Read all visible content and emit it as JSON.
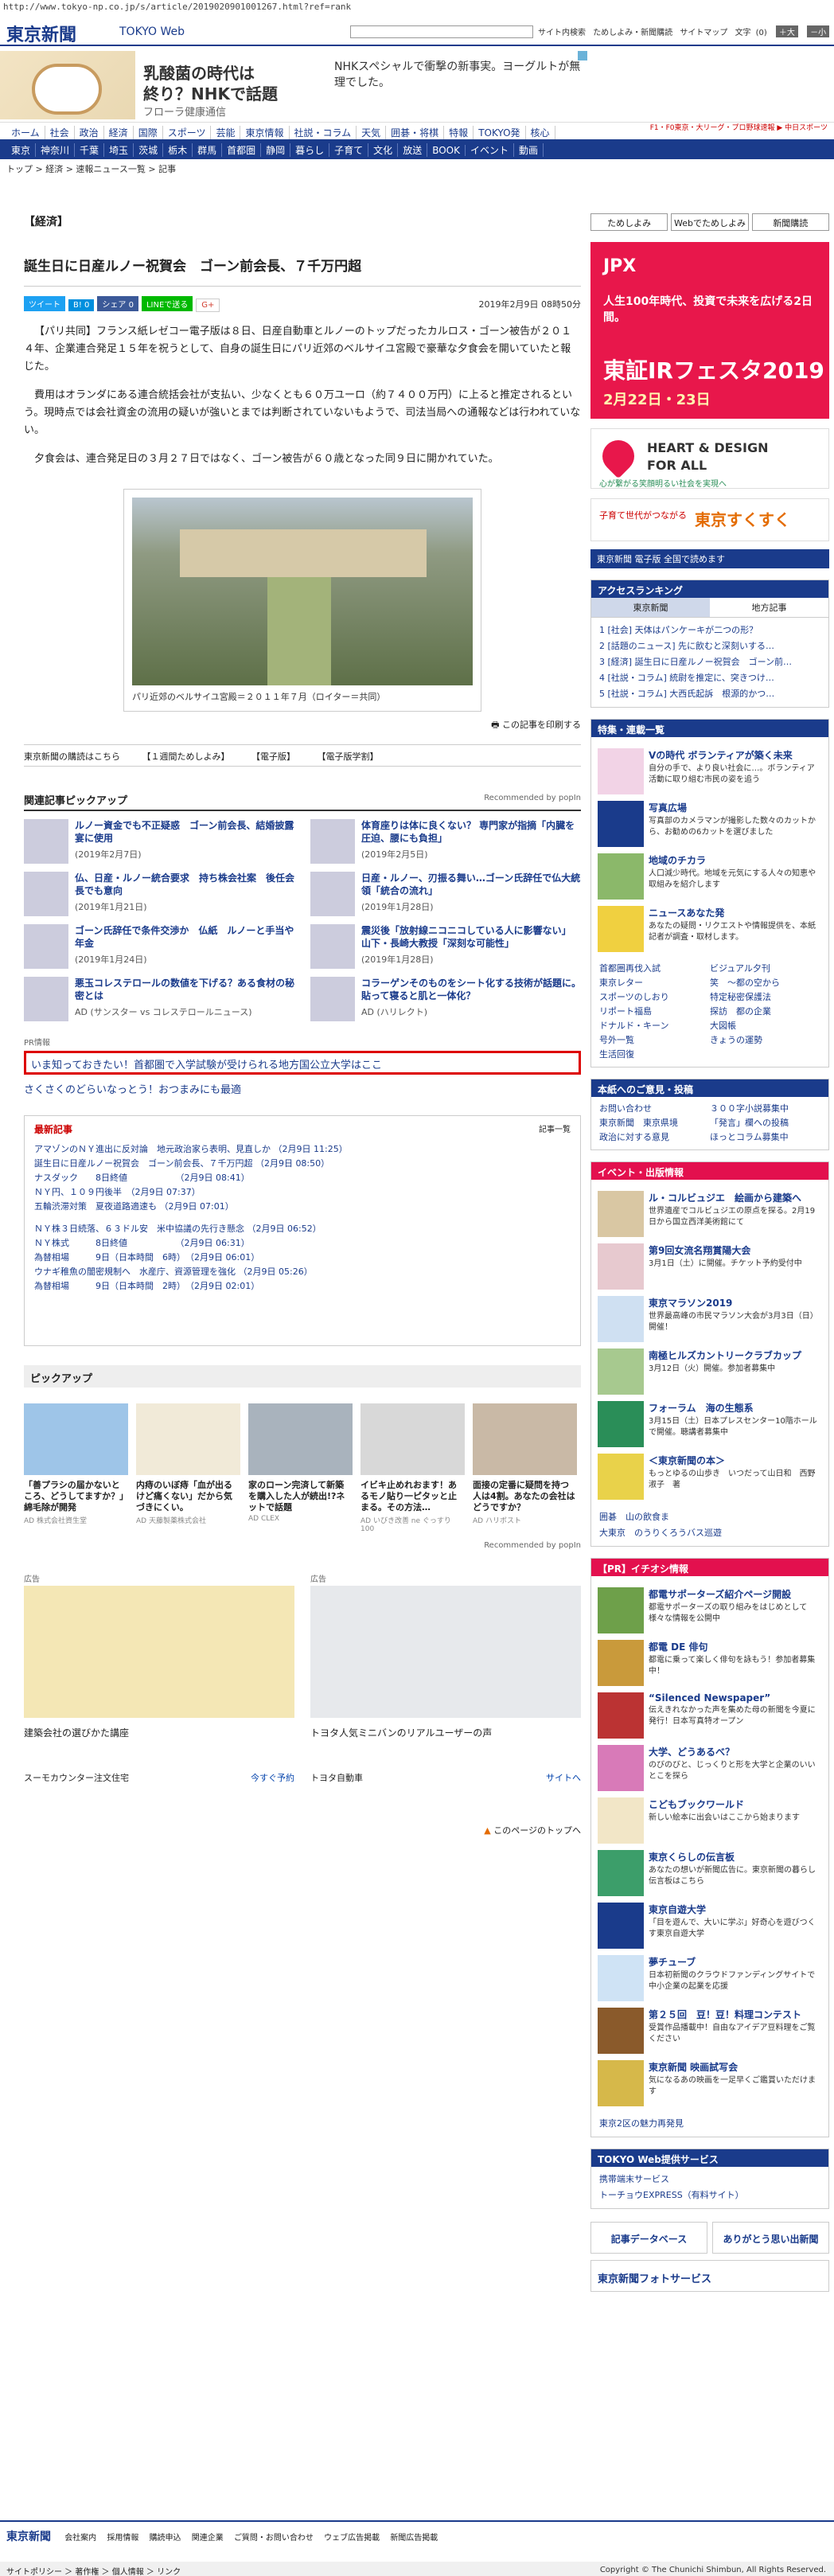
{
  "url": "http://www.tokyo-np.co.jp/s/article/2019020901001267.html?ref=rank",
  "header": {
    "logo": "東京新聞",
    "logo_sub": "TOKYO Web",
    "links": [
      "サイト内検索",
      "ためしよみ・新聞購読",
      "サイトマップ",
      "文字"
    ],
    "text_size": "(0)",
    "text_plus": "＋大",
    "text_minus": "－小"
  },
  "ad_top": {
    "headline1": "乳酸菌の時代は",
    "headline2": "終り？NHKで話題",
    "brand": "フローラ健康通信",
    "right_text": "NHKスペシャルで衝撃の新事実。ヨーグルトが無理でした。"
  },
  "nav1": [
    "ホーム",
    "社会",
    "政治",
    "経済",
    "国際",
    "スポーツ",
    "芸能",
    "東京情報",
    "社説・コラム",
    "天気",
    "囲碁・将棋",
    "特報",
    "TOKYO発",
    "核心"
  ],
  "nav1_right": "F1・F0東京・大リーグ・プロ野球速報 ▶ 中日スポーツ",
  "nav2": [
    "東京",
    "神奈川",
    "千葉",
    "埼玉",
    "茨城",
    "栃木",
    "群馬",
    "首都圏",
    "静岡",
    "暮らし",
    "子育て",
    "文化",
    "放送",
    "BOOK",
    "イベント",
    "動画"
  ],
  "breadcrumb": "トップ > 経済 > 速報ニュース一覧 > 記事",
  "article": {
    "section": "【経済】",
    "title": "誕生日に日産ルノー祝賀会　ゴーン前会長、７千万円超",
    "date": "2019年2月9日 08時50分",
    "share": [
      "ツイート",
      "B! 0",
      "シェア 0",
      "LINEで送る",
      "G+"
    ],
    "paragraphs": [
      "【パリ共同】フランス紙レゼコー電子版は８日、日産自動車とルノーのトップだったカルロス・ゴーン被告が２０１４年、企業連合発足１５年を祝うとして、自身の誕生日にパリ近郊のベルサイユ宮殿で豪華な夕食会を開いていたと報じた。",
      "費用はオランダにある連合統括会社が支払い、少なくとも６０万ユーロ（約７４００万円）に上ると推定されるという。現時点では会社資金の流用の疑いが強いとまでは判断されていないもようで、司法当局への通報などは行われていない。",
      "夕食会は、連合発足日の３月２７日ではなく、ゴーン被告が６０歳となった同９日に開かれていた。"
    ],
    "photo_caption": "パリ近郊のベルサイユ宮殿＝２０１１年７月（ロイター＝共同）",
    "print_label": "この記事を印刷する"
  },
  "linkbar": [
    "東京新聞の購読はこちら",
    "【１週間ためしよみ】",
    "【電子版】",
    "【電子版学割】"
  ],
  "related": {
    "heading": "関連記事ピックアップ",
    "recommend": "Recommended by popIn",
    "items": [
      {
        "title": "ルノー資金でも不正疑惑　ゴーン前会長、結婚披露宴に使用",
        "date": "(2019年2月7日)"
      },
      {
        "title": "体育座りは体に良くない？ 専門家が指摘「内臓を圧迫、腰にも負担」",
        "date": "(2019年2月5日)"
      },
      {
        "title": "仏、日産・ルノー統合要求　持ち株会社案　後任会長でも意向",
        "date": "(2019年1月21日)"
      },
      {
        "title": "日産・ルノー、刃振る舞い…ゴーン氏辞任で仏大統領「統合の流れ」",
        "date": "(2019年1月28日)"
      },
      {
        "title": "ゴーン氏辞任で条件交渉か　仏紙　ルノーと手当や年金",
        "date": "(2019年1月24日)"
      },
      {
        "title": "震災後「放射線ニコニコしている人に影響ない」 山下・長崎大教授「深刻な可能性」",
        "date": "(2019年1月28日)"
      },
      {
        "title": "悪玉コレステロールの数値を下げる？ある食材の秘密とは",
        "date": "AD (サンスター vs コレステロールニュース)"
      },
      {
        "title": "コラーゲンそのものをシート化する技術が話題に。貼って寝ると肌と一体化？",
        "date": "AD (ハリレクト)"
      }
    ]
  },
  "pr": {
    "label": "PR情報",
    "highlight": "いま知っておきたい！首都圏で入学試験が受けられる地方国公立大学はここ",
    "line2": "さくさくのどらいなっとう！おつまみにも最適"
  },
  "latest": {
    "heading": "最新記事",
    "all_link": "記事一覧",
    "items": [
      "アマゾンのＮＹ進出に反対論　地元政治家ら表明、見直しか （2月9日 11:25）",
      "誕生日に日産ルノー祝賀会　ゴーン前会長、７千万円超 （2月9日 08:50）",
      "ナスダック　　8日終値　　　　　　（2月9日 08:41）",
      "ＮＹ円、１０９円後半　（2月9日 07:37）",
      "五輪渋滞対策　夏夜道路適速も （2月9日 07:01）",
      "ＮＹ株３日続落、６３ドル安　米中協議の先行き懸念 （2月9日 06:52）",
      "ＮＹ株式　　　8日終値　　　　　　（2月9日 06:31）",
      "為替相場　　　9日（日本時間　6時）　（2月9日 06:01）",
      "ウナギ稚魚の闇密規制へ　水産庁、資源管理を強化 （2月9日 05:26）",
      "為替相場　　　9日（日本時間　2時）　（2月9日 02:01）"
    ]
  },
  "pickup": {
    "heading": "ピックアップ",
    "items": [
      {
        "title": "「善プラシの届かないところ、どうしてますか？」綿毛除が開発",
        "ad": "AD 株式会社資生堂"
      },
      {
        "title": "内痔のいぼ痔「血が出るけど痛くない」だから気づきにくい。",
        "ad": "AD 天藤製薬株式会社"
      },
      {
        "title": "家のローン完済して新築を購入した人が続出!?ネットで話題",
        "ad": "AD CLEX"
      },
      {
        "title": "イビキ止めれおます！あるモノ貼り一ピタッと止まる。その方法…",
        "ad": "AD いびき改善 ne ぐっすり 100"
      },
      {
        "title": "面接の定番に疑問を持つ人は4割。あなたの会社はどうですか？",
        "ad": "AD ハリボスト"
      }
    ],
    "recommend": "Recommended by popIn"
  },
  "ads_bottom": [
    {
      "label": "広告",
      "title": "建築会社の選びかた講座",
      "brand": "スーモカウンター注文住宅",
      "cta": "今すぐ予約"
    },
    {
      "label": "広告",
      "title": "トヨタ人気ミニバンのリアルユーザーの声",
      "brand": "トヨタ自動車",
      "cta": "サイトへ"
    }
  ],
  "page_top": "このページのトップへ",
  "sidebar": {
    "buttons": [
      "ためしよみ",
      "Webでためしよみ",
      "新聞購読"
    ],
    "banner": {
      "t1": "JPX",
      "t2": "人生100年時代、投資で未来を広げる2日間。",
      "t3": "東証IRフェスタ2019",
      "t4": "2月22日・23日"
    },
    "heart": {
      "t1": "HEART & DESIGN",
      "t2": "FOR ALL",
      "t3": "心が繋がる笑顔明るい社会を実現へ"
    },
    "kid": {
      "t0": "子育て世代がつながる",
      "t1": "東京すくすく"
    },
    "paper_bar": "東京新聞 電子版 全国で読めます",
    "ranking": {
      "heading": "アクセスランキング",
      "tabs": [
        "東京新聞",
        "地方記事"
      ],
      "items": [
        "1 [社会] 天体はパンケーキが二つの形？",
        "2 [話題のニュース] 先に飲むと深刻いする…",
        "3 [経済] 誕生日に日産ルノー祝賀会　ゴーン前…",
        "4 [社説・コラム] 統尉を推定に、突きつけ…",
        "5 [社説・コラム] 大西氏起訴　根源的かつ…"
      ]
    },
    "features": {
      "heading": "特集・連載一覧",
      "items": [
        {
          "title": "Vの時代 ボランティアが築く未来",
          "desc": "自分の手で、より良い社会に…。ボランティア活動に取り組む市民の姿を追う"
        },
        {
          "title": "写真広場",
          "desc": "写真部のカメラマンが撮影した数々のカットから、お勧めの6カットを選びました"
        },
        {
          "title": "地域のチカラ",
          "desc": "人口減少時代。地域を元気にする人々の知恵や取組みを紹介します"
        },
        {
          "title": "ニュースあなた発",
          "desc": "あなたの疑問・リクエストや情報提供を、本紙記者が調査・取材します。"
        }
      ],
      "grid": [
        "首都圏再伐入試",
        "東京レター",
        "スポーツのしおり",
        "リポート福島",
        "ドナルド・キーン",
        "号外一覧",
        "生活回復",
        "ビジュアル夕刊",
        "笑　～都の空から",
        "特定秘密保護法",
        "探訪　都の企業",
        "大図帳",
        "きょうの運勢"
      ]
    },
    "contacts": {
      "heading": "本紙へのご意見・投稿",
      "items": [
        "お問い合わせ",
        "東京新聞　東京県境",
        "政治に対する意見",
        "３００字小説募集中",
        "「発言」欄への投稿",
        "ほっとコラム募集中"
      ]
    },
    "events": {
      "heading": "イベント・出版情報",
      "items": [
        {
          "title": "ル・コルビュジエ　絵画から建築へ",
          "desc": "世界遺産でコルビュジエの原点を探る。2月19日から国立西洋美術館にて"
        },
        {
          "title": "第9回女流名翔賞陽大会",
          "desc": "3月1日（土）に開催。チケット予約受付中"
        },
        {
          "title": "東京マラソン2019",
          "desc": "世界最高峰の市民マラソン大会が3月3日（日）開催！"
        },
        {
          "title": "南極ヒルズカントリークラブカップ",
          "desc": "3月12日（火）開催。参加者募集中"
        },
        {
          "title": "フォーラム　海の生態系",
          "desc": "3月15日（土）日本プレスセンター10階ホールで開催。聴講者募集中"
        },
        {
          "title": "＜東京新聞の本＞",
          "desc": "もっとゆるの山歩き　いつだって山日和　西野淑子　著"
        }
      ],
      "links": [
        "囲碁　山の飲食ま",
        "大東京　のうりくろうバス巡遊"
      ]
    },
    "pr_info": {
      "heading": "【PR】イチオシ情報",
      "items": [
        {
          "title": "都電サポーターズ紹介ページ開設",
          "desc": "都電サポーターズの取り組みをはじめとして様々な情報を公開中"
        },
        {
          "title": "都電 DE 俳句",
          "desc": "都電に乗って楽しく俳句を詠もう！参加者募集中！"
        },
        {
          "title": "“Silenced Newspaper”",
          "desc": "伝えきれなかった声を集めた母の新聞を今夏に発行！日本写真特オープン"
        },
        {
          "title": "大学、どうあるべ？",
          "desc": "のびのびと、じっくりと形を大学と企業のいいとこを探ら"
        },
        {
          "title": "こどもブックワールド",
          "desc": "新しい絵本に出会いはここから始まります"
        },
        {
          "title": "東京くらしの伝言板",
          "desc": "あなたの想いが新聞広告に。東京新聞の暮らし伝言板はこちら"
        },
        {
          "title": "東京自遊大学",
          "desc": "「目を遊んで、大いに学ぶ」好奇心を遊びつくす東京自遊大学"
        },
        {
          "title": "夢チューブ",
          "desc": "日本初新聞のクラウドファンディングサイトで中小企業の起業を応援"
        },
        {
          "title": "第２５回　豆！豆！料理コンテスト",
          "desc": "受賞作品播載中！自由なアイデア豆料理をご覧ください"
        },
        {
          "title": "東京新聞 映画試写会",
          "desc": "気になるあの映画を一足早くご鑑賞いただけます"
        }
      ],
      "link": "東京2区の魅力再発見"
    },
    "tokyo_web": {
      "heading": "TOKYO Web提供サービス",
      "items": [
        "携帯端末サービス",
        "トーチョウEXPRESS（有料サイト）"
      ]
    },
    "footer_banners": [
      "記事データベース",
      "ありがとう思い出新聞"
    ],
    "photo_service": "東京新聞フォトサービス"
  },
  "footer": {
    "logo": "東京新聞",
    "links": [
      "会社案内",
      "採用情報",
      "購読申込",
      "関連企業",
      "ご質問・お問い合わせ",
      "ウェブ広告掲載",
      "新聞広告掲載"
    ],
    "bottom_links": "サイトポリシー ＞ 著作権 ＞ 個人情報 ＞ リンク",
    "copyright": "Copyright © The Chunichi Shimbun, All Rights Reserved."
  }
}
